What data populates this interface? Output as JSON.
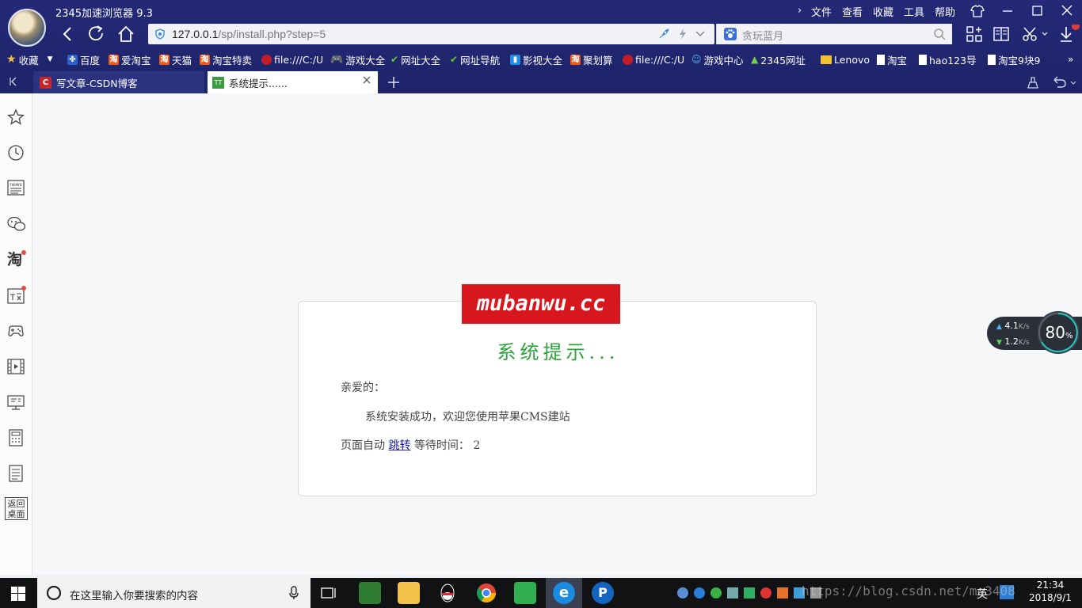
{
  "app": {
    "title": "2345加速浏览器 9.3"
  },
  "menu": [
    "文件",
    "查看",
    "收藏",
    "工具",
    "帮助"
  ],
  "address": {
    "url_host": "127.0.0.1",
    "url_path": "/sp/install.php?step=5"
  },
  "search": {
    "placeholder": "贪玩蓝月"
  },
  "bookmarks": {
    "favorites_label": "收藏",
    "items": [
      "百度",
      "爱淘宝",
      "天猫",
      "淘宝特卖",
      "file:///C:/U",
      "游戏大全",
      "网址大全",
      "网址导航",
      "影视大全",
      "聚划算",
      "file:///C:/U",
      "游戏中心",
      "2345网址",
      "Lenovo",
      "淘宝",
      "hao123导",
      "淘宝9块9"
    ]
  },
  "tabs": [
    {
      "label": "写文章-CSDN博客"
    },
    {
      "label": "系统提示......"
    }
  ],
  "page": {
    "logo_text": "mubanwu.cc",
    "title": "系统提示...",
    "greeting": "亲爱的：",
    "message": "系统安装成功，欢迎您使用苹果CMS建站",
    "redirect_prefix": "页面自动 ",
    "redirect_link": "跳转",
    "redirect_suffix": " 等待时间： ",
    "countdown": "2"
  },
  "sidebar": {
    "return_desktop": "返回桌面",
    "news_label": "news"
  },
  "speed_widget": {
    "upload": "4.1",
    "download": "1.2",
    "unit": "K/s",
    "percent": "80",
    "percent_sign": "%"
  },
  "taskbar": {
    "search_placeholder": "在这里输入你要搜索的内容",
    "ime": "英",
    "time": "21:34",
    "date": "2018/9/1"
  },
  "watermark": "https://blog.csdn.net/mo3408",
  "colors": {
    "chrome": "#1d2468",
    "logo_bg": "#d6171d",
    "title_green": "#2aa33a",
    "link": "#1a1aa6"
  }
}
